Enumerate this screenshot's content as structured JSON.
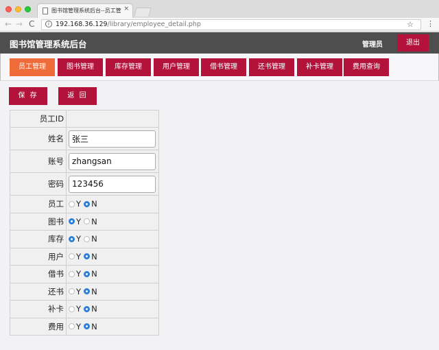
{
  "browser": {
    "tab_title": "图书馆管理系统后台--员工管理",
    "tab_close": "×",
    "url_host": "192.168.36.129",
    "url_path": "/library/employee_detail.php",
    "back_icon": "←",
    "forward_icon": "→",
    "reload_icon": "C",
    "info_icon": "i",
    "star_icon": "☆",
    "menu_icon": "⋮"
  },
  "header": {
    "title": "图书馆管理系统后台",
    "role": "管理员",
    "logout_label": "退出"
  },
  "nav": {
    "items": [
      {
        "label": "员工管理",
        "active": true
      },
      {
        "label": "图书管理",
        "active": false
      },
      {
        "label": "库存管理",
        "active": false
      },
      {
        "label": "用户管理",
        "active": false
      },
      {
        "label": "借书管理",
        "active": false
      },
      {
        "label": "还书管理",
        "active": false
      },
      {
        "label": "补卡管理",
        "active": false
      },
      {
        "label": "费用查询",
        "active": false
      }
    ]
  },
  "actions": {
    "save_label": "保 存",
    "back_label": "返 回"
  },
  "form": {
    "id_label": "员工ID",
    "id_value": "",
    "name_label": "姓名",
    "name_value": "张三",
    "account_label": "账号",
    "account_value": "zhangsan",
    "password_label": "密码",
    "password_value": "123456",
    "yes_label": "Y",
    "no_label": "N",
    "permissions": [
      {
        "label": "员工",
        "value": "N"
      },
      {
        "label": "图书",
        "value": "Y"
      },
      {
        "label": "库存",
        "value": "Y"
      },
      {
        "label": "用户",
        "value": "N"
      },
      {
        "label": "借书",
        "value": "N"
      },
      {
        "label": "还书",
        "value": "N"
      },
      {
        "label": "补卡",
        "value": "N"
      },
      {
        "label": "费用",
        "value": "N"
      }
    ]
  },
  "colors": {
    "accent": "#b3123b",
    "active_tab": "#ef6c3a",
    "header_bg": "#4e4e4e",
    "radio_on": "#2f7fd4"
  }
}
